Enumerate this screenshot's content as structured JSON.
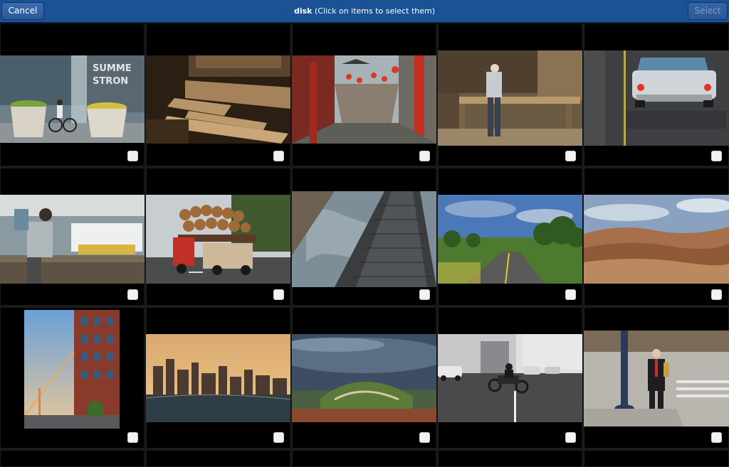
{
  "header": {
    "cancel_label": "Cancel",
    "title_bold": "disk",
    "title_rest": " (Click on items to select them)",
    "select_label": "Select"
  },
  "photos": [
    {
      "name": "cyclist-street",
      "desc": "cyclist passing planters in city"
    },
    {
      "name": "wood-planks",
      "desc": "stacked lumber boards"
    },
    {
      "name": "chinatown-street",
      "desc": "chinatown with red lanterns"
    },
    {
      "name": "carpenter-workshop",
      "desc": "man working at wood table"
    },
    {
      "name": "vintage-car",
      "desc": "classic car on asphalt"
    },
    {
      "name": "man-photographing-harbor",
      "desc": "man taking photo near ferry"
    },
    {
      "name": "logging-truck",
      "desc": "truck loaded with logs"
    },
    {
      "name": "skyscraper-sky",
      "desc": "tall building against sky"
    },
    {
      "name": "country-road",
      "desc": "road through green trees"
    },
    {
      "name": "desert-hills",
      "desc": "eroded desert landscape"
    },
    {
      "name": "bay-bridge-building",
      "desc": "bridge and brick building"
    },
    {
      "name": "city-skyline-sunset",
      "desc": "skyline at sunset"
    },
    {
      "name": "green-hill",
      "desc": "hill with winding path"
    },
    {
      "name": "motorcycle-street",
      "desc": "motorcycle in street"
    },
    {
      "name": "man-street-corner",
      "desc": "man in suit on sidewalk"
    }
  ]
}
